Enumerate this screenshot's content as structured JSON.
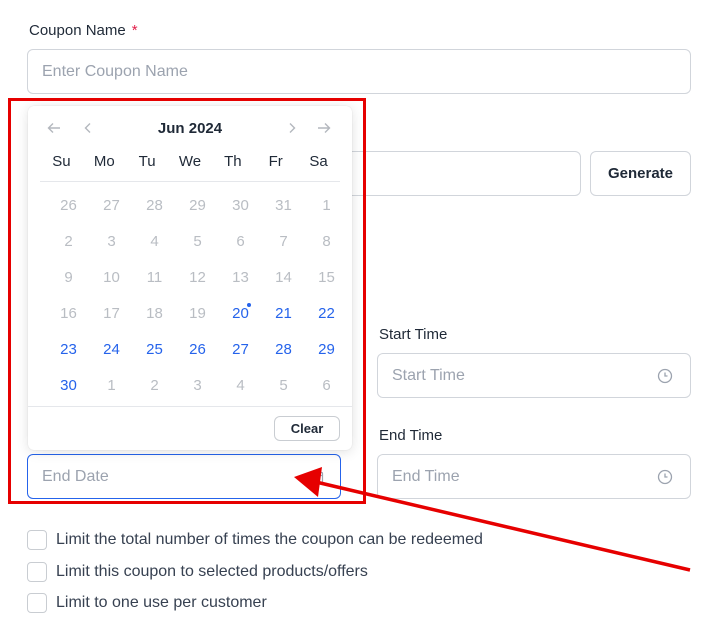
{
  "coupon_name": {
    "label": "Coupon Name",
    "required_mark": "*",
    "placeholder": "Enter Coupon Name"
  },
  "coupon_code": {
    "generate_label": "Generate"
  },
  "calendar": {
    "title": "Jun 2024",
    "weekdays": [
      "Su",
      "Mo",
      "Tu",
      "We",
      "Th",
      "Fr",
      "Sa"
    ],
    "weeks": [
      [
        "26",
        "27",
        "28",
        "29",
        "30",
        "31",
        "1"
      ],
      [
        "2",
        "3",
        "4",
        "5",
        "6",
        "7",
        "8"
      ],
      [
        "9",
        "10",
        "11",
        "12",
        "13",
        "14",
        "15"
      ],
      [
        "16",
        "17",
        "18",
        "19",
        "20",
        "21",
        "22"
      ],
      [
        "23",
        "24",
        "25",
        "26",
        "27",
        "28",
        "29"
      ],
      [
        "30",
        "1",
        "2",
        "3",
        "4",
        "5",
        "6"
      ]
    ],
    "today": "20",
    "clear_label": "Clear",
    "accent_color": "#2563eb"
  },
  "start_time": {
    "label": "Start Time",
    "placeholder": "Start Time"
  },
  "end_time": {
    "label": "End Time",
    "placeholder": "End Time"
  },
  "end_date": {
    "placeholder": "End Date"
  },
  "options": [
    {
      "label": "Limit the total number of times the coupon can be redeemed",
      "checked": false
    },
    {
      "label": "Limit this coupon to selected products/offers",
      "checked": false
    },
    {
      "label": "Limit to one use per customer",
      "checked": false
    }
  ],
  "annotation_color": "#e60000"
}
